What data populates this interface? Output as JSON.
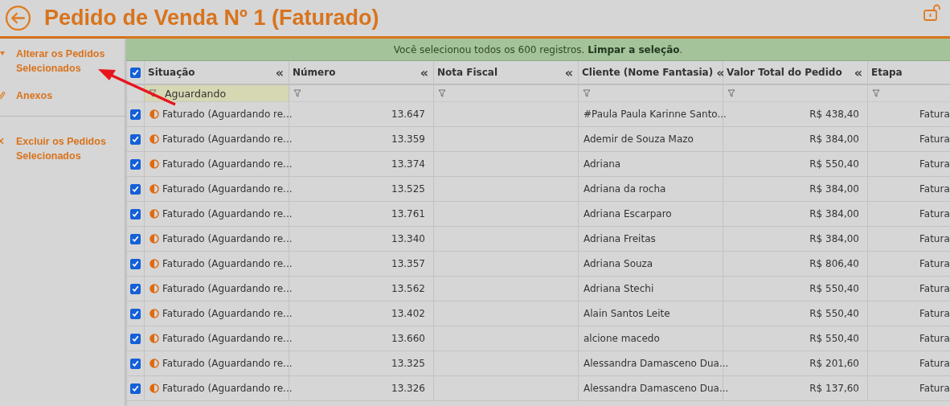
{
  "header": {
    "title": "Pedido de Venda Nº 1 (Faturado)"
  },
  "sidebar": {
    "items": [
      {
        "label": "Alterar os Pedidos Selecionados",
        "kind": "edit"
      },
      {
        "label": "Anexos",
        "kind": "attach"
      },
      {
        "label": "Excluir os Pedidos Selecionados",
        "kind": "delete"
      }
    ]
  },
  "banner": {
    "text": "Você selecionou todos os 600 registros.",
    "link": "Limpar a seleção",
    "after": "."
  },
  "table": {
    "all_checked": true,
    "columns": [
      {
        "label": "Situação",
        "filter": "Aguardando",
        "collapse": "«"
      },
      {
        "label": "Número",
        "collapse": "«"
      },
      {
        "label": "Nota Fiscal",
        "collapse": "«"
      },
      {
        "label": "Cliente (Nome Fantasia)",
        "collapse": "«"
      },
      {
        "label": "Valor Total do Pedido",
        "collapse": "«"
      },
      {
        "label": "Etapa"
      }
    ],
    "rows": [
      {
        "checked": true,
        "cells": [
          "Faturado (Aguardando re...",
          "13.647",
          "",
          "#Paula Paula Karinne Santo...",
          "R$ 438,40",
          "Fatura"
        ]
      },
      {
        "checked": true,
        "cells": [
          "Faturado (Aguardando re...",
          "13.359",
          "",
          "Ademir de Souza Mazo",
          "R$ 384,00",
          "Fatura"
        ]
      },
      {
        "checked": true,
        "cells": [
          "Faturado (Aguardando re...",
          "13.374",
          "",
          "Adriana",
          "R$ 550,40",
          "Fatura"
        ]
      },
      {
        "checked": true,
        "cells": [
          "Faturado (Aguardando re...",
          "13.525",
          "",
          "Adriana da rocha",
          "R$ 384,00",
          "Fatura"
        ]
      },
      {
        "checked": true,
        "cells": [
          "Faturado (Aguardando re...",
          "13.761",
          "",
          "Adriana Escarparo",
          "R$ 384,00",
          "Fatura"
        ]
      },
      {
        "checked": true,
        "cells": [
          "Faturado (Aguardando re...",
          "13.340",
          "",
          "Adriana Freitas",
          "R$ 384,00",
          "Fatura"
        ]
      },
      {
        "checked": true,
        "cells": [
          "Faturado (Aguardando re...",
          "13.357",
          "",
          "Adriana Souza",
          "R$ 806,40",
          "Fatura"
        ]
      },
      {
        "checked": true,
        "cells": [
          "Faturado (Aguardando re...",
          "13.562",
          "",
          "Adriana Stechi",
          "R$ 550,40",
          "Fatura"
        ]
      },
      {
        "checked": true,
        "cells": [
          "Faturado (Aguardando re...",
          "13.402",
          "",
          "Alain Santos Leite",
          "R$ 550,40",
          "Fatura"
        ]
      },
      {
        "checked": true,
        "cells": [
          "Faturado (Aguardando re...",
          "13.660",
          "",
          "alcione macedo",
          "R$ 550,40",
          "Fatura"
        ]
      },
      {
        "checked": true,
        "cells": [
          "Faturado (Aguardando re...",
          "13.325",
          "",
          "Alessandra Damasceno Dua...",
          "R$ 201,60",
          "Fatura"
        ]
      },
      {
        "checked": true,
        "cells": [
          "Faturado (Aguardando re...",
          "13.326",
          "",
          "Alessandra Damasceno Dua...",
          "R$ 137,60",
          "Fatura"
        ]
      }
    ]
  }
}
